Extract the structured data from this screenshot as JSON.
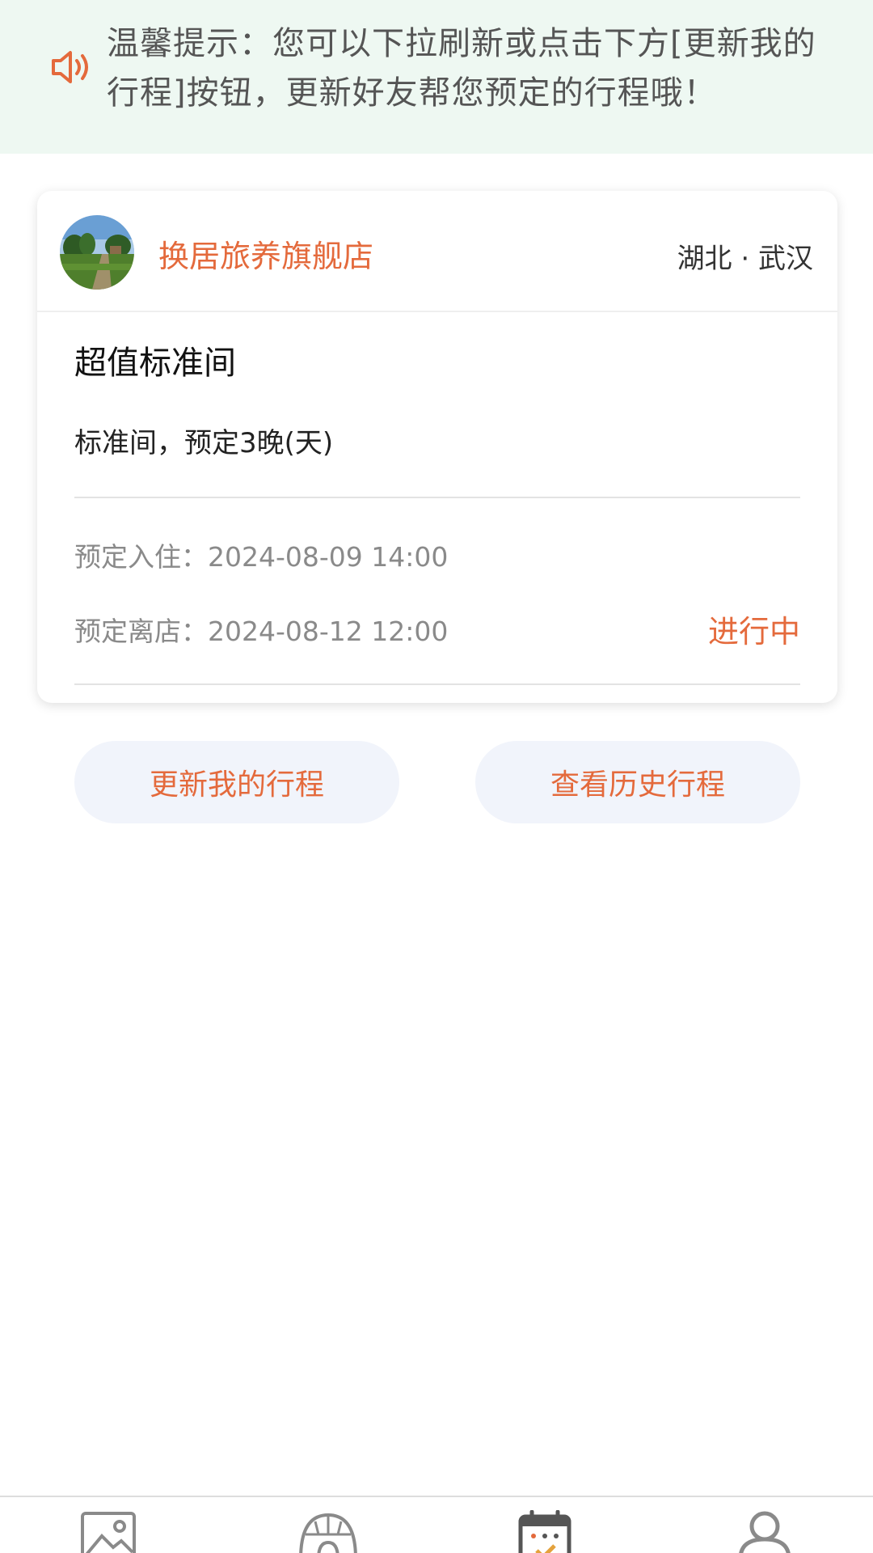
{
  "notice": {
    "icon": "speaker-icon",
    "text": "温馨提示：您可以下拉刷新或点击下方[更新我的行程]按钮，更新好友帮您预定的行程哦！"
  },
  "booking": {
    "store_name": "换居旅养旗舰店",
    "location": "湖北 · 武汉",
    "room_title": "超值标准间",
    "room_desc": "标准间，预定3晚(天)",
    "checkin": "预定入住：2024-08-09 14:00",
    "checkout": "预定离店：2024-08-12 12:00",
    "status": "进行中"
  },
  "buttons": {
    "update": "更新我的行程",
    "history": "查看历史行程"
  },
  "nav": {
    "items": [
      "image-icon",
      "dome-icon",
      "calendar-check-icon",
      "user-icon"
    ]
  },
  "colors": {
    "accent": "#e46a3c",
    "notice_bg": "#eef8f2",
    "button_bg": "#f1f4fb"
  }
}
